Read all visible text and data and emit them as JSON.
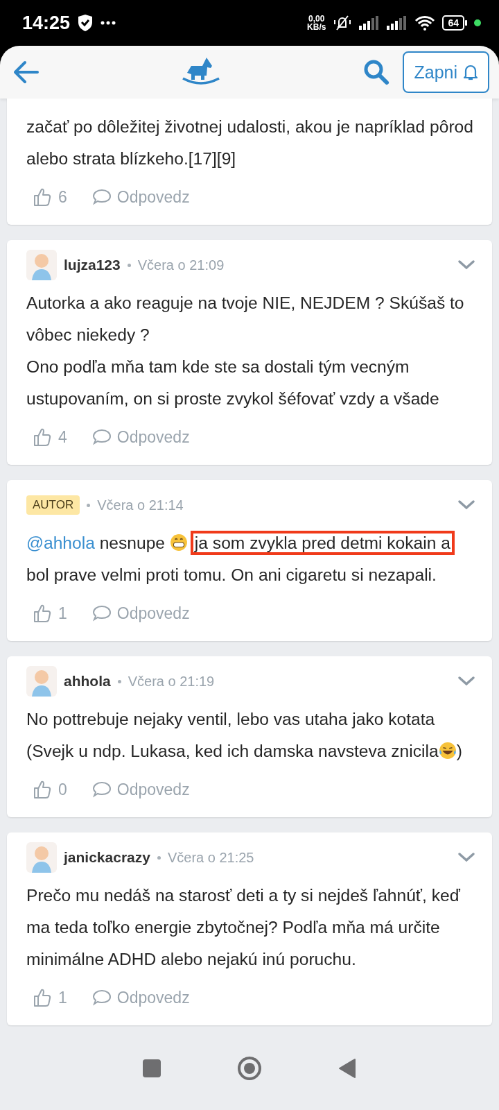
{
  "status_bar": {
    "time": "14:25",
    "net_speed": "0,00",
    "net_unit": "KB/s",
    "battery": "64"
  },
  "header": {
    "notify_button": "Zapni"
  },
  "comments": [
    {
      "author": {
        "kind": "hidden"
      },
      "body": [
        {
          "kind": "text",
          "text": "začať po dôležitej životnej udalosti, akou je napríklad pôrod alebo strata blízkeho.[17][9]"
        }
      ],
      "likes": "6",
      "reply": "Odpovedz"
    },
    {
      "author": {
        "kind": "user",
        "name": "lujza123"
      },
      "time": "Včera o 21:09",
      "body": [
        {
          "kind": "text",
          "text": "Autorka a ako reaguje na tvoje NIE, NEJDEM ? Skúšaš to vôbec niekedy ?\nOno podľa mňa tam kde ste sa dostali tým vecným ustupovaním, on si proste zvykol šéfovať vzdy a všade"
        }
      ],
      "likes": "4",
      "reply": "Odpovedz"
    },
    {
      "author": {
        "kind": "badge",
        "label": "AUTOR"
      },
      "time": "Včera o 21:14",
      "body": [
        {
          "kind": "mention",
          "text": "@ahhola"
        },
        {
          "kind": "text",
          "text": " nesnupe "
        },
        {
          "kind": "grin-emoji"
        },
        {
          "kind": "marked",
          "text": "ja som zvykla pred detmi kokain a"
        },
        {
          "kind": "text",
          "text": " bol prave velmi proti tomu. On ani cigaretu si nezapali."
        }
      ],
      "likes": "1",
      "reply": "Odpovedz"
    },
    {
      "author": {
        "kind": "user",
        "name": "ahhola"
      },
      "time": "Včera o 21:19",
      "body": [
        {
          "kind": "text",
          "text": "No pottrebuje nejaky ventil, lebo vas utaha jako kotata (Svejk u ndp. Lukasa, ked ich damska navsteva znicila"
        },
        {
          "kind": "laugh-emoji"
        },
        {
          "kind": "text",
          "text": ")"
        }
      ],
      "likes": "0",
      "reply": "Odpovedz"
    },
    {
      "author": {
        "kind": "user",
        "name": "janickacrazy"
      },
      "time": "Včera o 21:25",
      "body": [
        {
          "kind": "text",
          "text": "Prečo mu nedáš na starosť deti a ty si nejdeš ľahnúť, keď ma teda toľko energie zbytočnej? Podľa mňa má určite minimálne ADHD alebo nejakú inú poruchu."
        }
      ],
      "likes": "1",
      "reply": "Odpovedz"
    }
  ]
}
